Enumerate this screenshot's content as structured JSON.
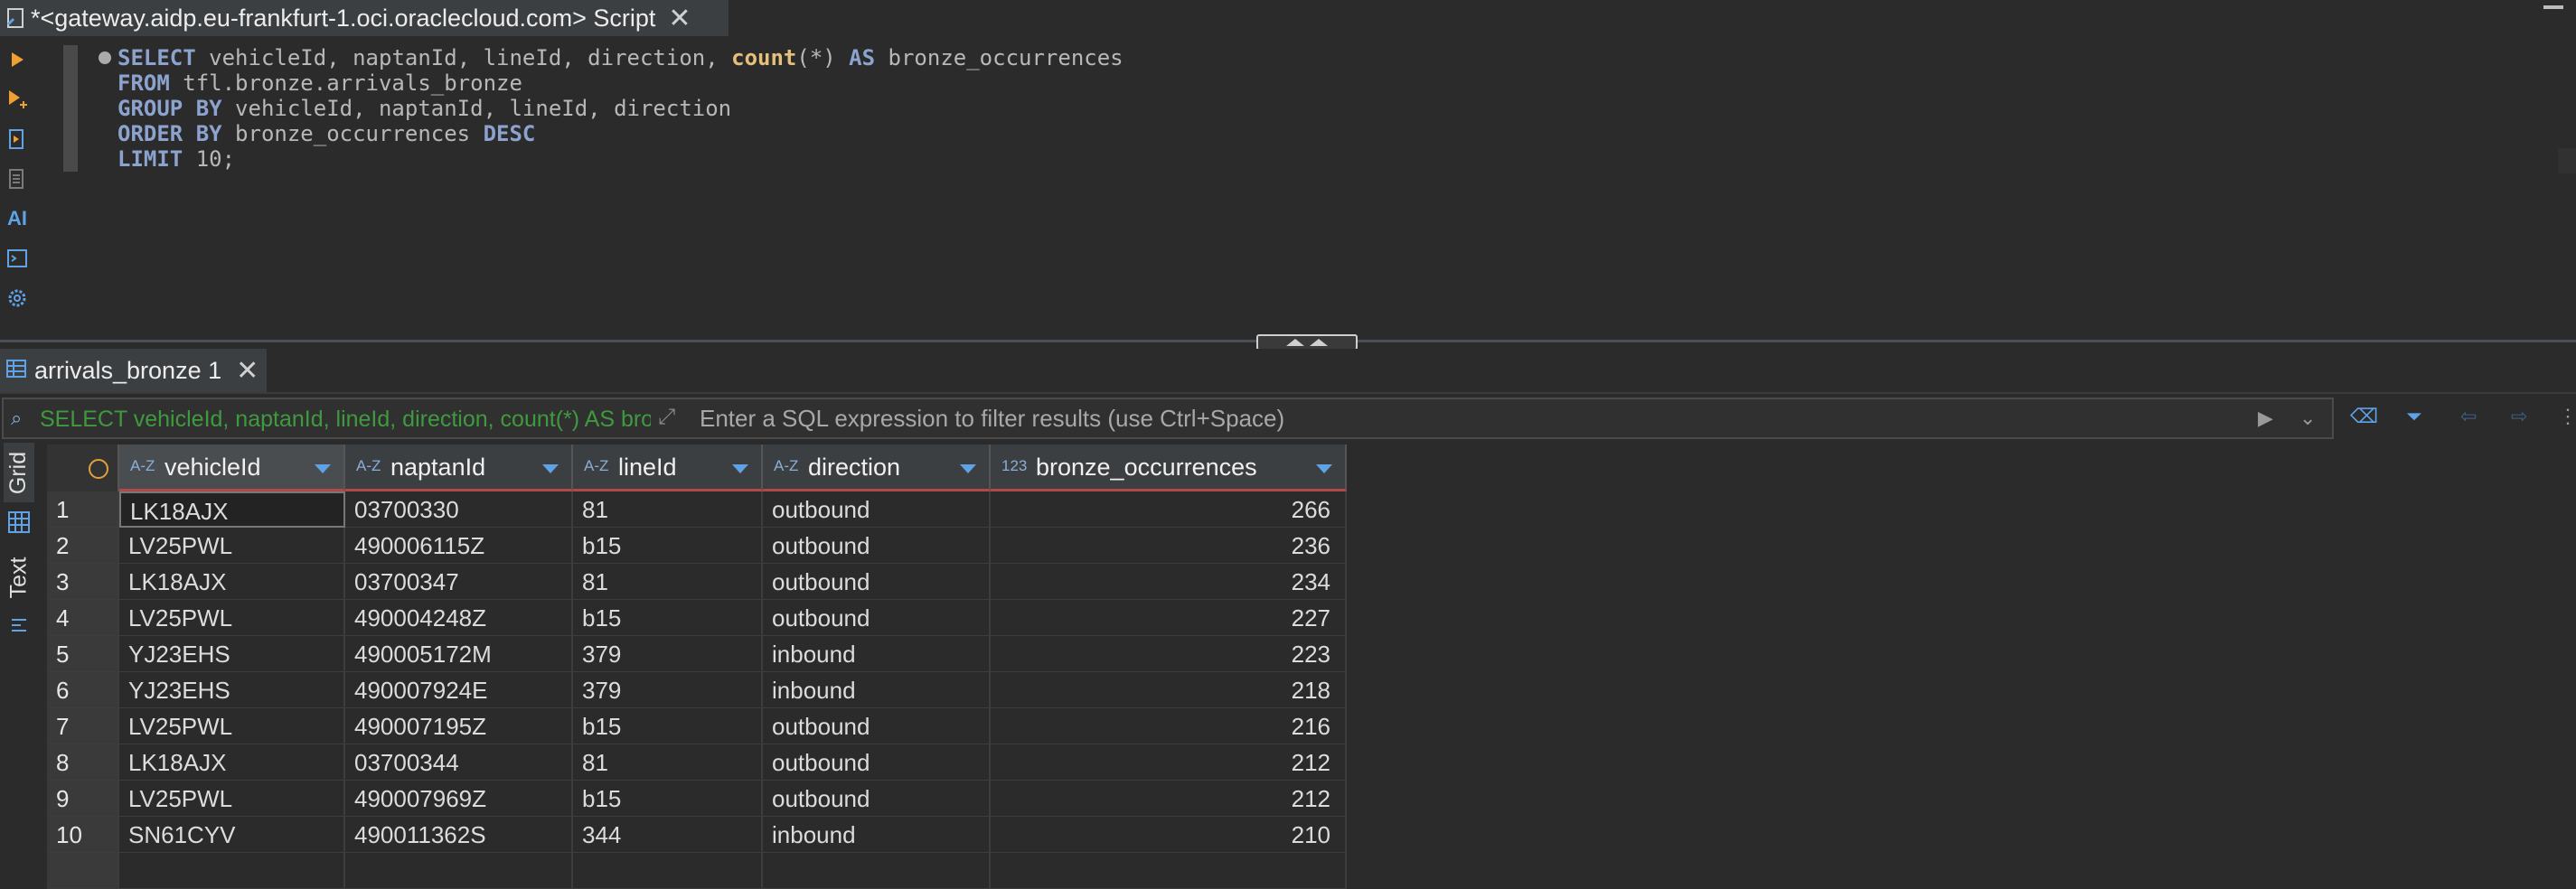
{
  "editor": {
    "tab_title": "*<gateway.aidp.eu-frankfurt-1.oci.oraclecloud.com> Script",
    "tab_icon": "sql-script-icon",
    "close_icon": "close-icon"
  },
  "toolbar": {
    "icons": [
      "execute-statement-icon",
      "execute-script-icon",
      "explain-plan-icon",
      "load-plan-icon",
      "ai-assistant-icon",
      "terminal-icon",
      "settings-icon"
    ],
    "ai_label": "AI"
  },
  "sql": {
    "line1": {
      "kw1": "SELECT",
      "t1": " vehicleId, naptanId, lineId, direction, ",
      "fn": "count",
      "t2": "(*) ",
      "kw2": "AS",
      "t3": " bronze_occurrences"
    },
    "line2": {
      "kw": "FROM",
      "t": " tfl.bronze.arrivals_bronze"
    },
    "line3": {
      "kw": "GROUP BY",
      "t": " vehicleId, naptanId, lineId, direction"
    },
    "line4": {
      "kw1": "ORDER BY",
      "t": " bronze_occurrences ",
      "kw2": "DESC"
    },
    "line5": {
      "kw": "LIMIT",
      "t": " 10;"
    }
  },
  "results": {
    "tab_label": "arrivals_bronze 1",
    "filter_query": "SELECT vehicleId, naptanId, lineId, direction, count(*) AS bronze_occurrences",
    "filter_placeholder": "Enter a SQL expression to filter results (use Ctrl+Space)",
    "side_tabs": {
      "grid": "Grid",
      "text": "Text"
    },
    "columns": [
      {
        "type": "A-Z",
        "name": "vehicleId"
      },
      {
        "type": "A-Z",
        "name": "naptanId"
      },
      {
        "type": "A-Z",
        "name": "lineId"
      },
      {
        "type": "A-Z",
        "name": "direction"
      },
      {
        "type": "123",
        "name": "bronze_occurrences"
      }
    ],
    "rows": [
      {
        "n": "1",
        "vehicleId": "LK18AJX",
        "naptanId": "03700330",
        "lineId": "81",
        "direction": "outbound",
        "count": "266"
      },
      {
        "n": "2",
        "vehicleId": "LV25PWL",
        "naptanId": "490006115Z",
        "lineId": "b15",
        "direction": "outbound",
        "count": "236"
      },
      {
        "n": "3",
        "vehicleId": "LK18AJX",
        "naptanId": "03700347",
        "lineId": "81",
        "direction": "outbound",
        "count": "234"
      },
      {
        "n": "4",
        "vehicleId": "LV25PWL",
        "naptanId": "490004248Z",
        "lineId": "b15",
        "direction": "outbound",
        "count": "227"
      },
      {
        "n": "5",
        "vehicleId": "YJ23EHS",
        "naptanId": "490005172M",
        "lineId": "379",
        "direction": "inbound",
        "count": "223"
      },
      {
        "n": "6",
        "vehicleId": "YJ23EHS",
        "naptanId": "490007924E",
        "lineId": "379",
        "direction": "inbound",
        "count": "218"
      },
      {
        "n": "7",
        "vehicleId": "LV25PWL",
        "naptanId": "490007195Z",
        "lineId": "b15",
        "direction": "outbound",
        "count": "216"
      },
      {
        "n": "8",
        "vehicleId": "LK18AJX",
        "naptanId": "03700344",
        "lineId": "81",
        "direction": "outbound",
        "count": "212"
      },
      {
        "n": "9",
        "vehicleId": "LV25PWL",
        "naptanId": "490007969Z",
        "lineId": "b15",
        "direction": "outbound",
        "count": "212"
      },
      {
        "n": "10",
        "vehicleId": "SN61CYV",
        "naptanId": "490011362S",
        "lineId": "344",
        "direction": "inbound",
        "count": "210"
      }
    ]
  },
  "colors": {
    "accent": "#5fa3e6",
    "keyword": "#8da3cf",
    "function": "#e5c07b",
    "filter_text": "#3f9a3f",
    "header_underline": "#b04a4a"
  }
}
